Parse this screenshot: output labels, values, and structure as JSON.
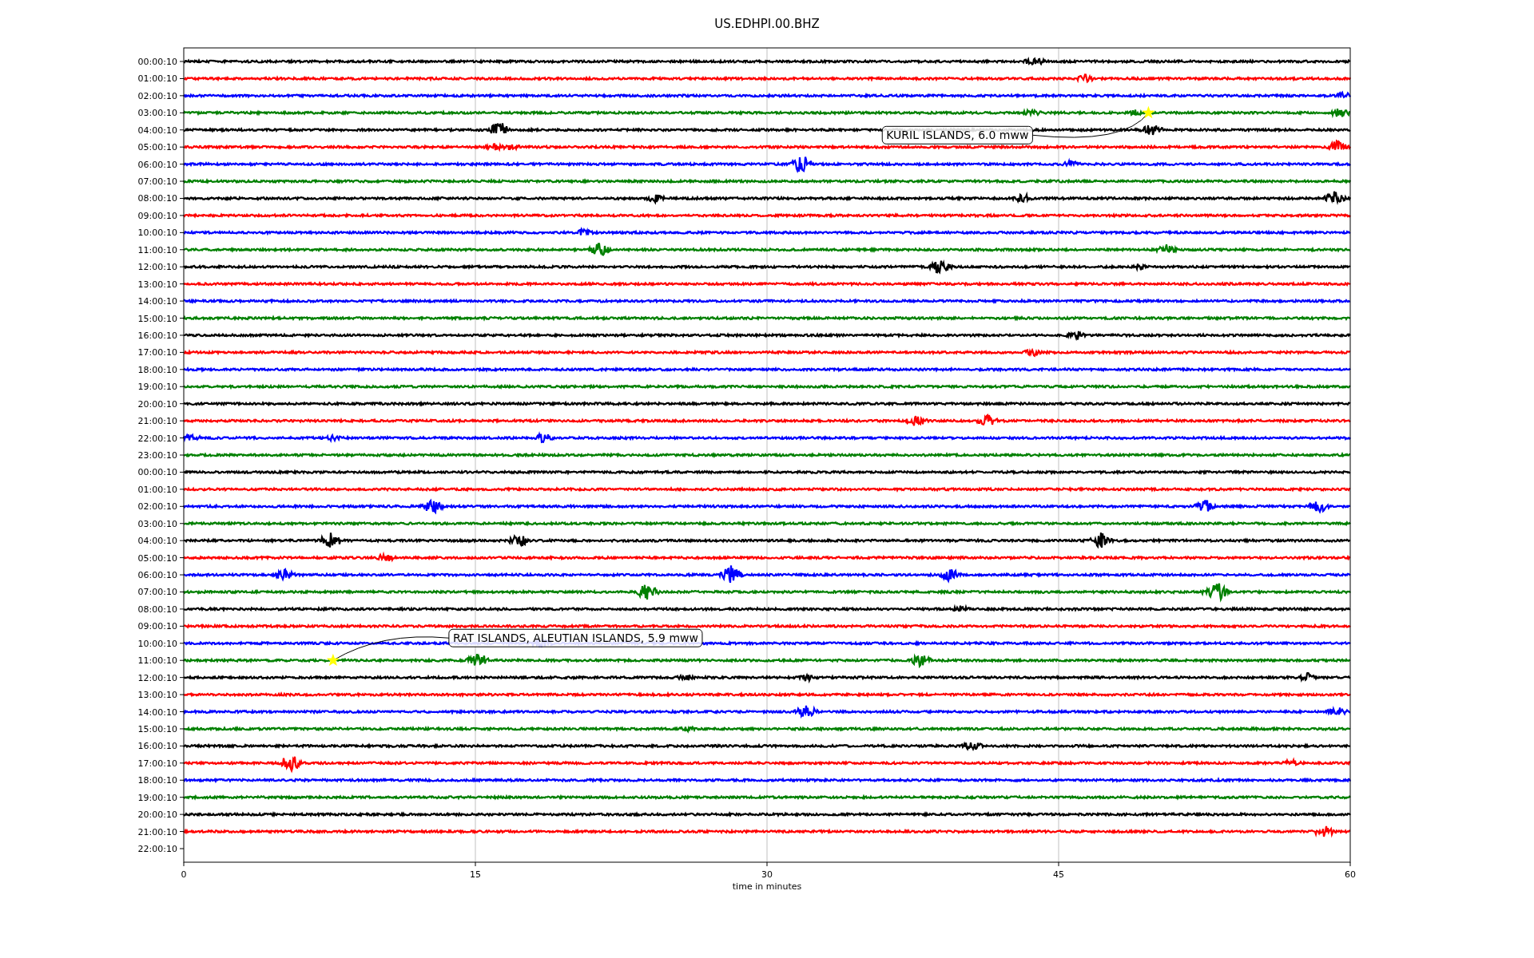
{
  "title": "US.EDHPI.00.BHZ",
  "time_labels": [
    "00:00:10",
    "01:00:10",
    "02:00:10",
    "03:00:10",
    "04:00:10",
    "05:00:10",
    "06:00:10",
    "07:00:10",
    "08:00:10",
    "09:00:10",
    "10:00:10",
    "11:00:10",
    "12:00:10",
    "13:00:10",
    "14:00:10",
    "15:00:10",
    "16:00:10",
    "17:00:10",
    "18:00:10",
    "19:00:10",
    "20:00:10",
    "21:00:10",
    "22:00:10",
    "23:00:10",
    "00:00:10",
    "01:00:10",
    "02:00:10",
    "03:00:10",
    "04:00:10",
    "05:00:10",
    "06:00:10",
    "07:00:10",
    "08:00:10",
    "09:00:10",
    "10:00:10",
    "11:00:10",
    "12:00:10",
    "13:00:10",
    "14:00:10",
    "15:00:10",
    "16:00:10",
    "17:00:10",
    "18:00:10",
    "19:00:10",
    "20:00:10",
    "21:00:10",
    "22:00:10"
  ],
  "x_tick_labels": [
    "0",
    "15",
    "30",
    "45",
    "60"
  ],
  "x_axis_label": "time in minutes",
  "traces": [
    {
      "color": "#000000"
    },
    {
      "color": "#ff0000"
    },
    {
      "color": "#0000ff"
    },
    {
      "color": "#008000",
      "event": {
        "label": "KURIL ISLANDS, 6.0 mww",
        "level": 0.827
      }
    },
    {
      "color": "#000000"
    },
    {
      "color": "#ff0000"
    },
    {
      "color": "#0000ff"
    },
    {
      "color": "#008000"
    },
    {
      "color": "#000000"
    },
    {
      "color": "#ff0000"
    },
    {
      "color": "#0000ff"
    },
    {
      "color": "#008000"
    },
    {
      "color": "#000000"
    },
    {
      "color": "#ff0000"
    },
    {
      "color": "#0000ff"
    },
    {
      "color": "#008000"
    },
    {
      "color": "#000000"
    },
    {
      "color": "#ff0000"
    },
    {
      "color": "#0000ff"
    },
    {
      "color": "#008000"
    },
    {
      "color": "#000000"
    },
    {
      "color": "#ff0000"
    },
    {
      "color": "#0000ff"
    },
    {
      "color": "#008000"
    },
    {
      "color": "#000000"
    },
    {
      "color": "#ff0000"
    },
    {
      "color": "#0000ff"
    },
    {
      "color": "#008000"
    },
    {
      "color": "#000000"
    },
    {
      "color": "#ff0000"
    },
    {
      "color": "#0000ff"
    },
    {
      "color": "#008000"
    },
    {
      "color": "#000000"
    },
    {
      "color": "#ff0000"
    },
    {
      "color": "#0000ff"
    },
    {
      "color": "#008000",
      "event": {
        "label": "RAT ISLANDS, ALEUTIAN ISLANDS, 5.9 mww",
        "level": 0.128
      }
    },
    {
      "color": "#000000"
    },
    {
      "color": "#ff0000"
    },
    {
      "color": "#0000ff"
    },
    {
      "color": "#008000"
    },
    {
      "color": "#000000"
    },
    {
      "color": "#ff0000"
    },
    {
      "color": "#0000ff"
    },
    {
      "color": "#008000"
    },
    {
      "color": "#000000"
    },
    {
      "color": "#ff0000"
    }
  ]
}
